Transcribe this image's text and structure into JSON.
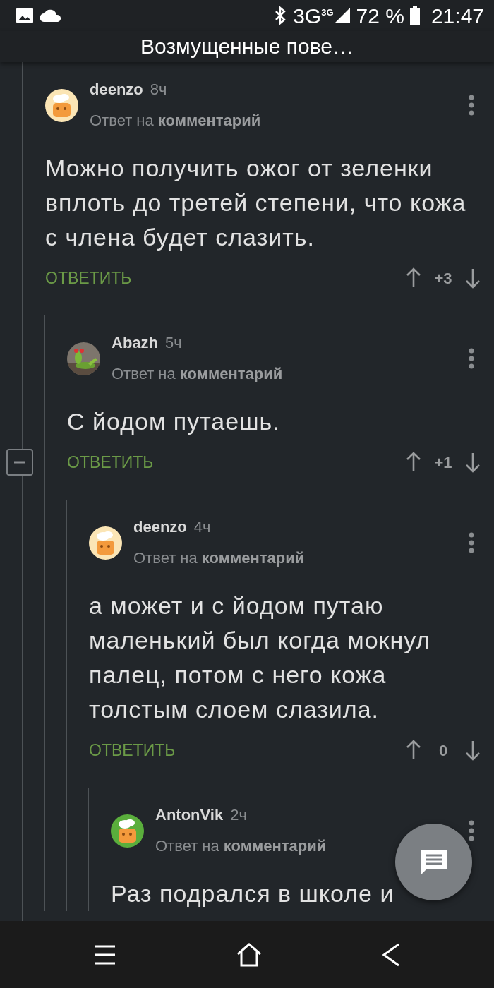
{
  "status_bar": {
    "network": "3G",
    "network_small": "3G",
    "battery": "72 %",
    "time": "21:47"
  },
  "header": {
    "title": "Возмущенные пове…"
  },
  "comments": [
    {
      "author": "deenzo",
      "time": "8ч",
      "meta": "Ответ на **комментарий**",
      "avatar": {
        "kind": "cartoon"
      },
      "text": "Можно получить ожог от зеленки вплоть до третей степени, что кожа с члена будет слазить.",
      "reply": "ОТВЕТИТЬ",
      "score": "+3",
      "expanded": true,
      "children": [
        {
          "author": "Abazh",
          "time": "5ч",
          "meta": "Ответ на **комментарий**",
          "text": "С йодом путаешь.",
          "reply": "ОТВЕТИТЬ",
          "score": "+1",
          "children": [
            {
              "author": "deenzo",
              "time": "4ч",
              "meta": "Ответ на **комментарий**",
              "avatar": {
                "kind": "cartoon"
              },
              "text": "а может и с йодом путаю маленький был когда мокнул палец, потом с него кожа толстым слоем слазила.",
              "reply": "ОТВЕТИТЬ",
              "score": "0",
              "children": [
                {
                  "author": "AntonVik",
                  "time": "2ч",
                  "meta": "Ответ на **комментарий**",
                  "avatar": {
                    "kind": "cartoon-green"
                  },
                  "text": "Раз подрался в школе и"
                }
              ]
            }
          ]
        }
      ]
    }
  ]
}
